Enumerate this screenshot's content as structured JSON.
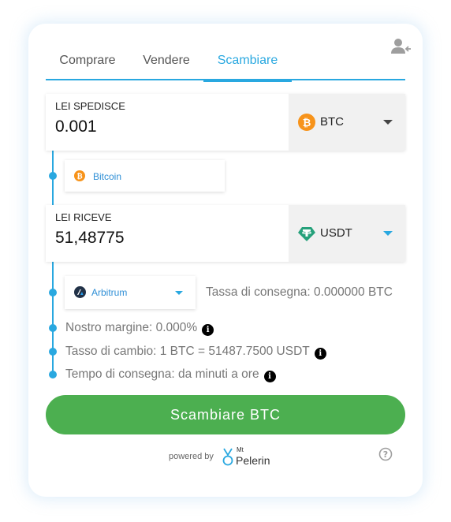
{
  "tabs": [
    {
      "label": "Comprare"
    },
    {
      "label": "Vendere"
    },
    {
      "label": "Scambiare",
      "active": true
    }
  ],
  "send": {
    "label": "LEI SPEDISCE",
    "value": "0.001",
    "currency": "BTC",
    "currency_icon": "bitcoin-icon"
  },
  "send_network": {
    "label": "Bitcoin",
    "icon": "bitcoin-icon"
  },
  "receive": {
    "label": "LEI RICEVE",
    "value": "51,48775",
    "currency": "USDT",
    "currency_icon": "tether-icon"
  },
  "receive_network": {
    "label": "Arbitrum",
    "icon": "arbitrum-icon"
  },
  "delivery_fee": "Tassa di consegna: 0.000000 BTC",
  "info": {
    "margin": "Nostro margine: 0.000%",
    "rate": "Tasso di cambio: 1 BTC = 51487.7500 USDT",
    "delivery_time": "Tempo di consegna: da minuti a ore"
  },
  "cta_label": "Scambiare BTC",
  "footer": {
    "powered_by": "powered by",
    "logo_mt": "Mt",
    "logo_name": "Pelerin"
  },
  "colors": {
    "accent": "#29a8e0",
    "cta": "#4caf50",
    "bitcoin": "#f7931a",
    "tether": "#26a17b"
  }
}
